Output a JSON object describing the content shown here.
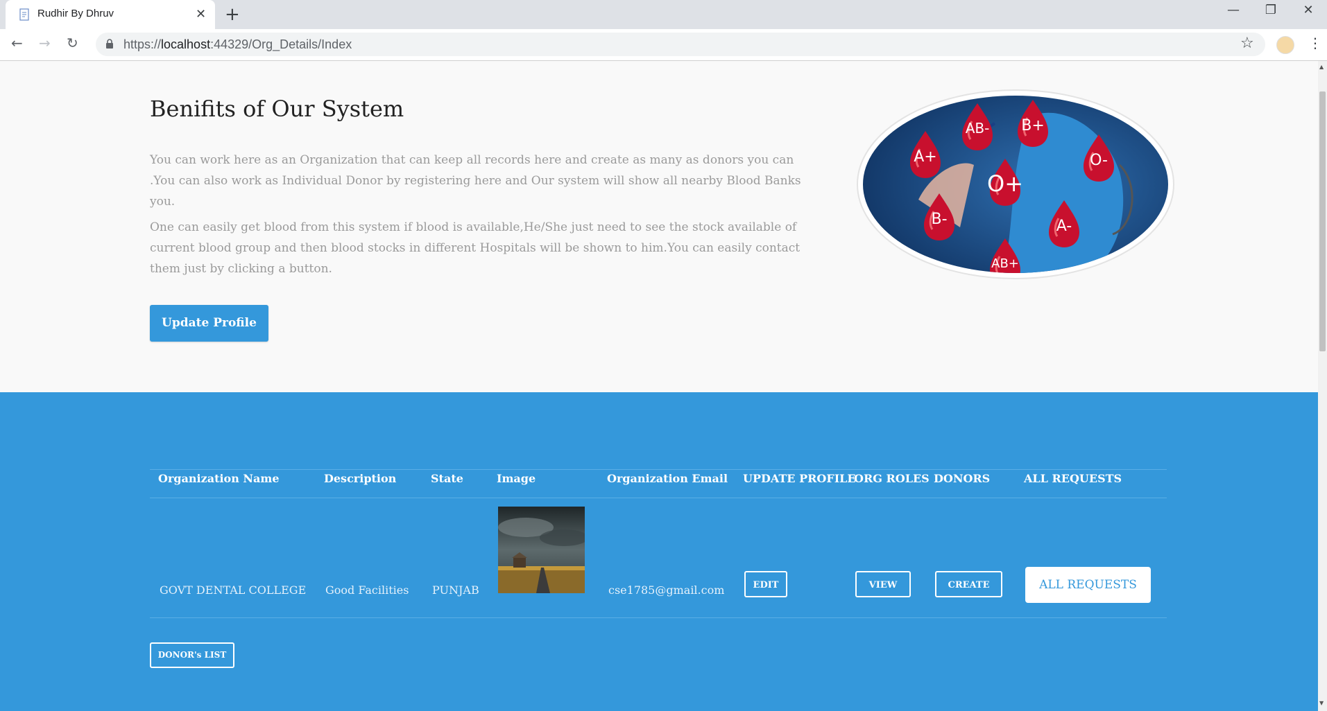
{
  "browser": {
    "tab_title": "Rudhir By Dhruv",
    "url_prefix": "https://",
    "url_host": "localhost",
    "url_rest": ":44329/Org_Details/Index"
  },
  "benefits": {
    "title": "Benifits of Our System",
    "para1": "You can work here as an Organization that can keep all records here and create as many as donors you can .You can also work as Individual Donor by registering here and Our system will show all nearby Blood Banks you.",
    "para2": "One can easily get blood from this system if blood is available,He/She just need to see the stock available of current blood group and then blood stocks in different Hospitals will be shown to him.You can easily contact them just by clicking a button.",
    "update_button": "Update Profile",
    "blood_groups": [
      "AB-",
      "B+",
      "A+",
      "O-",
      "O+",
      "B-",
      "A-",
      "AB+"
    ]
  },
  "table": {
    "headers": [
      "Organization Name",
      "Description",
      "State",
      "Image",
      "Organization Email",
      "UPDATE PROFILE",
      "ORG ROLES",
      "DONORS",
      "ALL REQUESTS"
    ],
    "row": {
      "org_name": "GOVT DENTAL COLLEGE",
      "description": "Good Facilities",
      "state": "PUNJAB",
      "email": "cse1785@gmail.com",
      "edit": "EDIT",
      "view": "VIEW",
      "create": "CREATE",
      "all_requests": "ALL REQUESTS"
    }
  },
  "donors_list_button": "DONOR's LIST"
}
